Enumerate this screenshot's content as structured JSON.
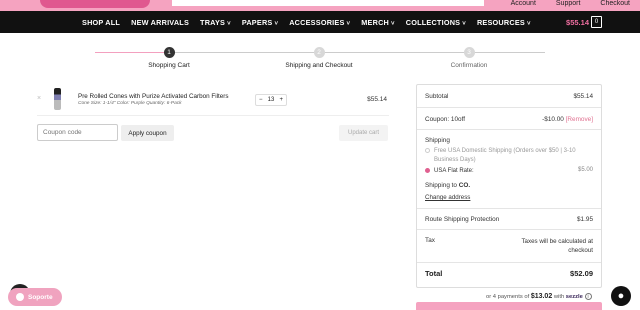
{
  "top_links": [
    "Account",
    "Support",
    "Checkout"
  ],
  "nav": {
    "items": [
      {
        "label": "SHOP ALL",
        "dropdown": false
      },
      {
        "label": "NEW ARRIVALS",
        "dropdown": false
      },
      {
        "label": "TRAYS",
        "dropdown": true
      },
      {
        "label": "PAPERS",
        "dropdown": true
      },
      {
        "label": "ACCESSORIES",
        "dropdown": true
      },
      {
        "label": "MERCH",
        "dropdown": true
      },
      {
        "label": "COLLECTIONS",
        "dropdown": true
      },
      {
        "label": "RESOURCES",
        "dropdown": true
      }
    ],
    "cart_total": "$55.14",
    "cart_count": "0"
  },
  "steps": [
    {
      "num": "1",
      "label": "Shopping Cart"
    },
    {
      "num": "2",
      "label": "Shipping and Checkout"
    },
    {
      "num": "3",
      "label": "Confirmation"
    }
  ],
  "cart": {
    "remove_symbol": "×",
    "product_name": "Pre Rolled Cones with Purize Activated Carbon Filters",
    "product_meta": "Cone Size: 1-1/4\"   Color: Purple   Quantity: 6-Pack",
    "qty_minus": "−",
    "qty": "13",
    "qty_plus": "+",
    "price": "$55.14"
  },
  "coupon": {
    "placeholder": "Coupon code",
    "apply_label": "Apply coupon",
    "update_label": "Update cart"
  },
  "totals": {
    "subtotal_label": "Subtotal",
    "subtotal_value": "$55.14",
    "coupon_label": "Coupon: 10off",
    "coupon_value": "-$10.00",
    "coupon_remove": "[Remove]",
    "shipping_label": "Shipping",
    "ship_option_1": "Free USA Domestic Shipping (Orders over $50 | 3-10 Business Days)",
    "ship_option_2_label": "USA Flat Rate:",
    "ship_option_2_value": "$5.00",
    "shipping_to_prefix": "Shipping to",
    "shipping_to_value": "CO.",
    "change_address": "Change address",
    "route_label": "Route Shipping Protection",
    "route_value": "$1.95",
    "tax_label": "Tax",
    "tax_value": "Taxes will be calculated at checkout",
    "total_label": "Total",
    "total_value": "$52.09"
  },
  "pay4": {
    "prefix": "or 4 payments of",
    "amount": "$13.02",
    "with": "with",
    "brand": "sezzle",
    "info": "i"
  },
  "soporte_label": "Soporte",
  "accessibility_icon": "accessibility-icon",
  "colors": {
    "accent_pink": "#f5a3c0",
    "nav_bg": "#111111",
    "total_pink": "#f06fa1"
  }
}
